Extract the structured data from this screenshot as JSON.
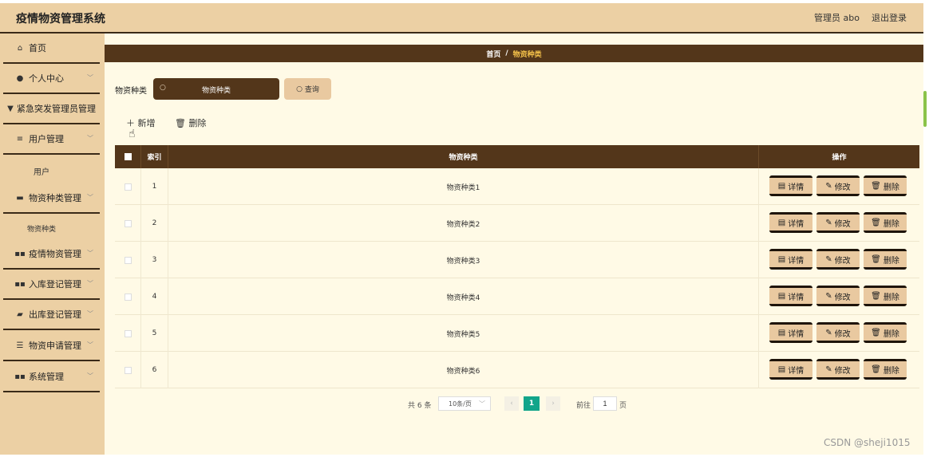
{
  "header": {
    "title": "疫情物资管理系统",
    "user": "管理员 abo",
    "logout": "退出登录"
  },
  "sidebar": {
    "items": [
      {
        "label": "首页",
        "icon": "home-icon",
        "glyph": "⌂"
      },
      {
        "label": "个人中心",
        "icon": "person-icon",
        "glyph": "●"
      },
      {
        "label": "紧急突发管理员管理",
        "icon": "flag-icon",
        "glyph": "▼"
      },
      {
        "label": "用户管理",
        "icon": "menu-icon",
        "glyph": "≡"
      },
      {
        "label": "物资种类管理",
        "icon": "monitor-icon",
        "glyph": "▬"
      },
      {
        "label": "疫情物资管理",
        "icon": "grid-icon",
        "glyph": "▪"
      },
      {
        "label": "入库登记管理",
        "icon": "grid-icon",
        "glyph": "▪"
      },
      {
        "label": "出库登记管理",
        "icon": "ticket-icon",
        "glyph": "▰"
      },
      {
        "label": "物资申请管理",
        "icon": "sliders-icon",
        "glyph": "☰"
      },
      {
        "label": "系统管理",
        "icon": "grid-icon",
        "glyph": "▪"
      }
    ],
    "sub_user": "用户",
    "sub_category": "物资种类"
  },
  "breadcrumb": {
    "home": "首页",
    "separator": "/",
    "current": "物资种类"
  },
  "search": {
    "label": "物资种类",
    "placeholder": "物资种类",
    "query_label": "查询"
  },
  "toolbar": {
    "add_label": "新增",
    "delete_label": "删除"
  },
  "table": {
    "headers": {
      "index": "索引",
      "type": "物资种类",
      "operation": "操作"
    },
    "rows": [
      {
        "index": "1",
        "type": "物资种类1"
      },
      {
        "index": "2",
        "type": "物资种类2"
      },
      {
        "index": "3",
        "type": "物资种类3"
      },
      {
        "index": "4",
        "type": "物资种类4"
      },
      {
        "index": "5",
        "type": "物资种类5"
      },
      {
        "index": "6",
        "type": "物资种类6"
      }
    ],
    "actions": {
      "detail": "详情",
      "edit": "修改",
      "delete": "删除"
    }
  },
  "pagination": {
    "total": "共 6 条",
    "page_size": "10条/页",
    "current_page": "1",
    "goto_label": "前往",
    "goto_value": "1",
    "page_unit": "页"
  },
  "watermark": "CSDN @sheji1015",
  "colors": {
    "header_bg": "#ecd0a4",
    "dark_brown": "#53361a",
    "content_bg": "#fffae6",
    "accent_green": "#12a58a",
    "breadcrumb_current": "#f5c24a"
  }
}
